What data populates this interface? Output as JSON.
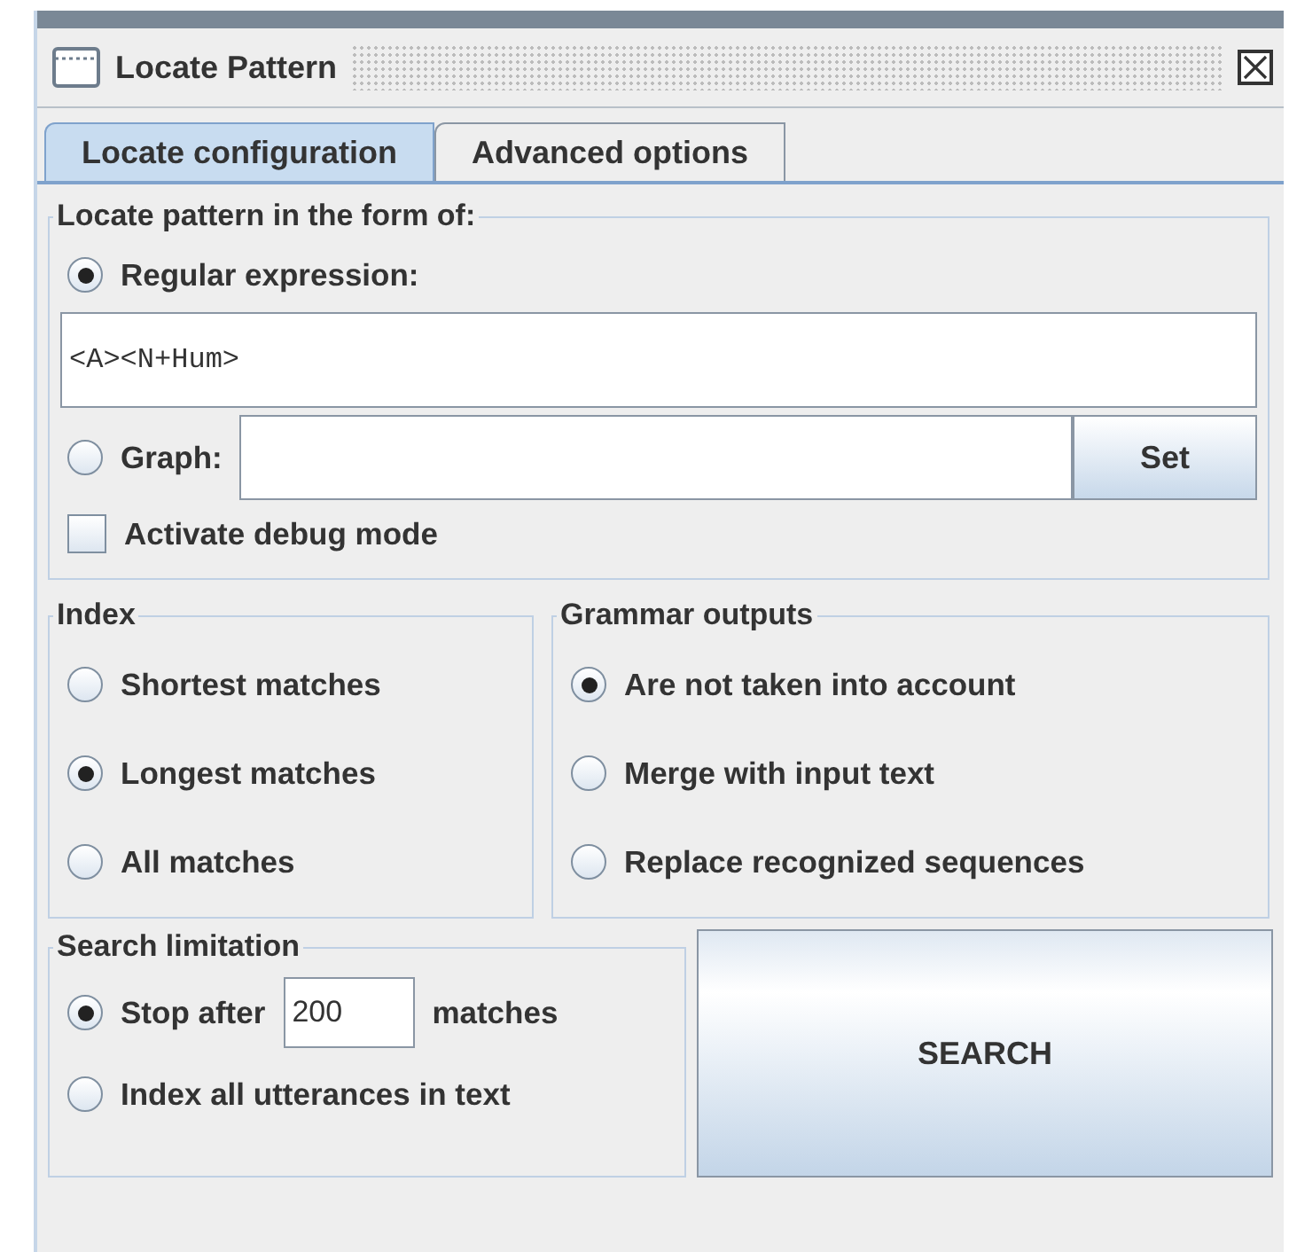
{
  "window": {
    "title": "Locate Pattern"
  },
  "tabs": [
    {
      "label": "Locate configuration",
      "selected": true
    },
    {
      "label": "Advanced options",
      "selected": false
    }
  ],
  "pattern_group": {
    "legend": "Locate pattern in the form of:",
    "options": [
      {
        "kind": "regex",
        "label": "Regular expression:",
        "selected": true,
        "value": "<A><N+Hum>"
      },
      {
        "kind": "graph",
        "label": "Graph:",
        "selected": false,
        "button": "Set"
      }
    ],
    "debug": {
      "label": "Activate debug mode",
      "checked": false
    }
  },
  "index": {
    "legend": "Index",
    "options": [
      {
        "label": "Shortest matches",
        "selected": false
      },
      {
        "label": "Longest matches",
        "selected": true
      },
      {
        "label": "All matches",
        "selected": false
      }
    ]
  },
  "grammar_outputs": {
    "legend": "Grammar outputs",
    "options": [
      {
        "label": "Are not taken into account",
        "selected": true
      },
      {
        "label": "Merge with input text",
        "selected": false
      },
      {
        "label": "Replace recognized sequences",
        "selected": false
      }
    ]
  },
  "search_limitation": {
    "legend": "Search limitation",
    "options": [
      {
        "kind": "stop",
        "label": "Stop after",
        "value": "200",
        "suffix": "matches",
        "selected": true
      },
      {
        "kind": "all",
        "label": "Index all utterances in text",
        "selected": false
      }
    ]
  },
  "search_button": "SEARCH"
}
